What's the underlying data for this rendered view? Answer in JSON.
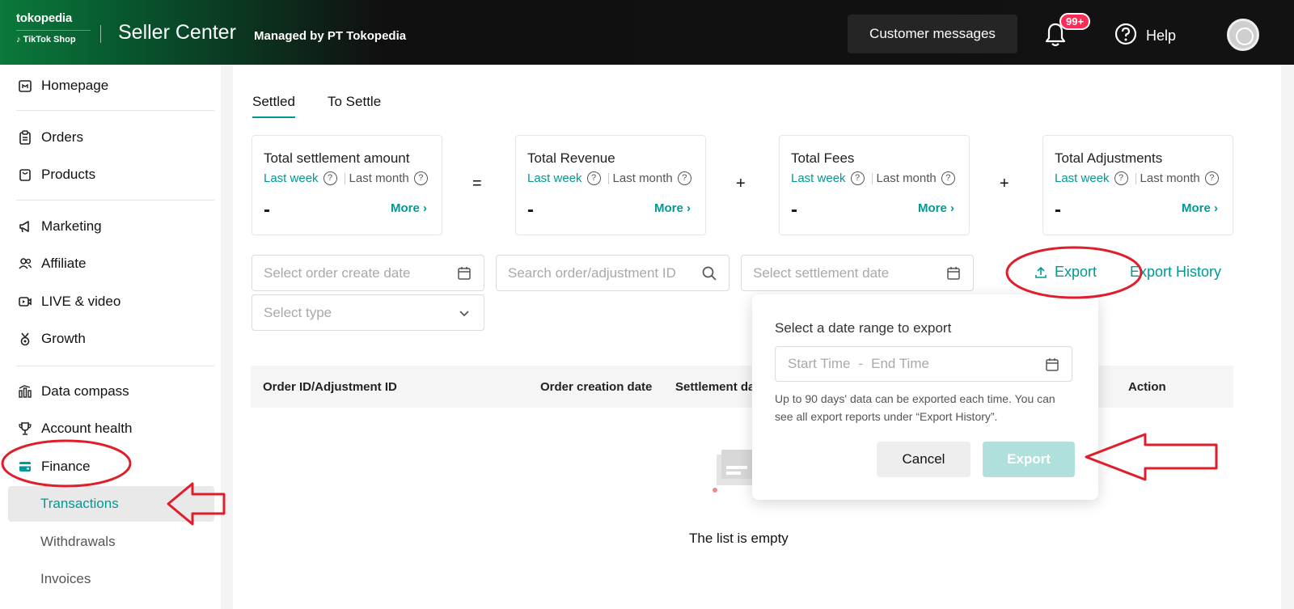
{
  "header": {
    "logo_line1": "tokopedia",
    "logo_line2": "TikTok Shop",
    "title": "Seller Center",
    "managed_by": "Managed by PT Tokopedia",
    "customer_messages": "Customer messages",
    "notification_badge": "99+",
    "help": "Help"
  },
  "sidebar": {
    "items": [
      {
        "label": "Homepage",
        "icon": "home-icon"
      },
      {
        "label": "Orders",
        "icon": "clipboard-icon"
      },
      {
        "label": "Products",
        "icon": "bag-icon"
      },
      {
        "label": "Marketing",
        "icon": "megaphone-icon"
      },
      {
        "label": "Affiliate",
        "icon": "people-icon"
      },
      {
        "label": "LIVE & video",
        "icon": "video-icon"
      },
      {
        "label": "Growth",
        "icon": "medal-icon"
      },
      {
        "label": "Data compass",
        "icon": "bar-chart-icon"
      },
      {
        "label": "Account health",
        "icon": "trophy-icon"
      },
      {
        "label": "Finance",
        "icon": "wallet-icon"
      }
    ],
    "finance_sub": [
      {
        "label": "Transactions",
        "active": true
      },
      {
        "label": "Withdrawals",
        "active": false
      },
      {
        "label": "Invoices",
        "active": false
      }
    ]
  },
  "tabs": [
    {
      "label": "Settled",
      "active": true
    },
    {
      "label": "To Settle",
      "active": false
    }
  ],
  "summary": {
    "last_week": "Last week",
    "last_month": "Last month",
    "more": "More",
    "cards": [
      {
        "title": "Total settlement amount",
        "value": "-"
      },
      {
        "title": "Total Revenue",
        "value": "-"
      },
      {
        "title": "Total Fees",
        "value": "-"
      },
      {
        "title": "Total Adjustments",
        "value": "-"
      }
    ],
    "operators": [
      "=",
      "+",
      "+"
    ]
  },
  "filters": {
    "order_create_date": "Select order create date",
    "search_id": "Search order/adjustment ID",
    "settlement_date": "Select settlement date",
    "type": "Select type"
  },
  "export": {
    "export_label": "Export",
    "history_label": "Export History"
  },
  "table": {
    "columns": [
      "Order ID/Adjustment ID",
      "Order creation date",
      "Settlement da",
      "Action"
    ],
    "empty_text": "The list is empty"
  },
  "popup": {
    "title": "Select a date range to export",
    "start_placeholder": "Start Time",
    "separator": "-",
    "end_placeholder": "End Time",
    "hint": "Up to 90 days' data can be exported each time. You can see all export reports under “Export History”.",
    "cancel": "Cancel",
    "export": "Export"
  },
  "colors": {
    "accent": "#009995",
    "annotation": "#e01e2b",
    "export_disabled": "#b0e0dc"
  }
}
